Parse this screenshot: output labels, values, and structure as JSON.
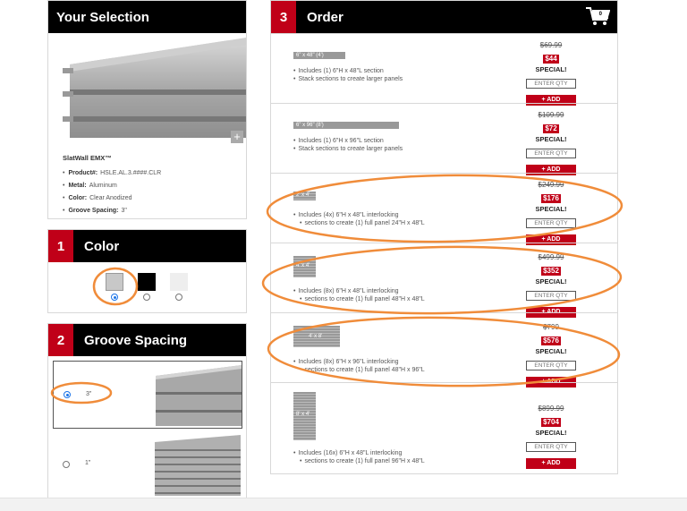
{
  "selection": {
    "title": "Your Selection",
    "product_name": "SlatWall EMX™",
    "specs": [
      {
        "label": "Product#:",
        "value": "HSLE.AL.3.####.CLR"
      },
      {
        "label": "Metal:",
        "value": "Aluminum"
      },
      {
        "label": "Color:",
        "value": "Clear Anodized"
      },
      {
        "label": "Groove Spacing:",
        "value": "3\""
      }
    ],
    "zoom_label": "+"
  },
  "color": {
    "step": "1",
    "title": "Color",
    "swatches": [
      {
        "name": "Silver",
        "hex": "#c8c8c8",
        "selected": true
      },
      {
        "name": "Black",
        "hex": "#000000",
        "selected": false
      },
      {
        "name": "White",
        "hex": "#eeeeee",
        "selected": false
      }
    ]
  },
  "groove": {
    "step": "2",
    "title": "Groove Spacing",
    "options": [
      {
        "label": "3\"",
        "selected": true
      },
      {
        "label": "1\"",
        "selected": false
      }
    ]
  },
  "order": {
    "step": "3",
    "title": "Order",
    "cart_count": "0",
    "qty_placeholder": "ENTER QTY",
    "add_label": "+ ADD",
    "special_label": "SPECIAL!",
    "items": [
      {
        "size": "6\" x 48\" (4')",
        "desc": [
          "Includes (1) 6\"H x 48\"L section",
          "Stack sections to create larger panels"
        ],
        "old_price": "$69.99",
        "price": "$44"
      },
      {
        "size": "6\" x 96\" (8')",
        "desc": [
          "Includes (1) 6\"H x 96\"L section",
          "Stack sections to create larger panels"
        ],
        "old_price": "$109.99",
        "price": "$72"
      },
      {
        "size": "2' x 4'",
        "desc": [
          "Includes (4x) 6\"H x 48\"L interlocking",
          "sections to create (1) full panel 24\"H x 48\"L"
        ],
        "old_price": "$249.99",
        "price": "$176"
      },
      {
        "size": "4' x 4'",
        "desc": [
          "Includes (8x) 6\"H x 48\"L interlocking",
          "sections to create (1) full panel 48\"H x 48\"L"
        ],
        "old_price": "$499.99",
        "price": "$352"
      },
      {
        "size": "4' x 8'",
        "desc": [
          "Includes (8x) 6\"H x 96\"L interlocking",
          "sections to create (1) full panel 48\"H x 96\"L"
        ],
        "old_price": "$799",
        "price": "$576"
      },
      {
        "size": "8' x 4'",
        "desc": [
          "Includes (16x) 6\"H x 48\"L interlocking",
          "sections to create (1) full panel 96\"H x 48\"L"
        ],
        "old_price": "$899.99",
        "price": "$704"
      }
    ]
  },
  "annotation_color": "#f08c3a",
  "accent_color": "#c00018"
}
